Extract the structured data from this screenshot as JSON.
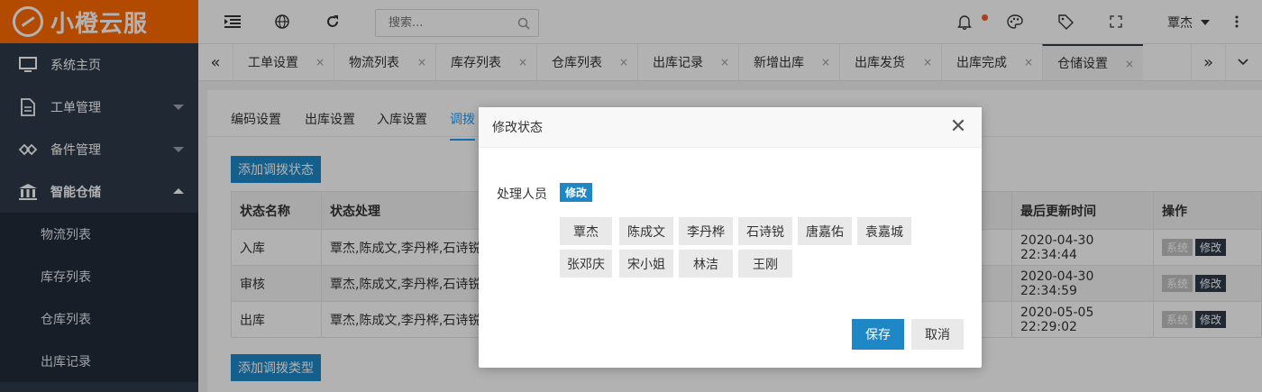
{
  "app": {
    "logo_text": "小橙云服",
    "brand_color": "#ff6a00"
  },
  "sidebar": {
    "items": [
      {
        "label": "系统主页",
        "icon": "monitor-icon"
      },
      {
        "label": "工单管理",
        "icon": "document-icon"
      },
      {
        "label": "备件管理",
        "icon": "diamond-link-icon"
      },
      {
        "label": "智能仓储",
        "icon": "bank-icon",
        "open": true
      }
    ],
    "subitems": [
      {
        "label": "物流列表"
      },
      {
        "label": "库存列表"
      },
      {
        "label": "仓库列表"
      },
      {
        "label": "出库记录"
      }
    ]
  },
  "header": {
    "search_placeholder": "搜索...",
    "user_name": "覃杰",
    "icons": [
      "menu-indent-icon",
      "globe-icon",
      "refresh-icon",
      "search-icon",
      "bell-icon",
      "palette-icon",
      "tag-icon",
      "fullscreen-icon",
      "more-vertical-icon"
    ]
  },
  "tabs": [
    {
      "label": "工单设置"
    },
    {
      "label": "物流列表"
    },
    {
      "label": "库存列表"
    },
    {
      "label": "仓库列表"
    },
    {
      "label": "出库记录"
    },
    {
      "label": "新增出库"
    },
    {
      "label": "出库发货"
    },
    {
      "label": "出库完成"
    },
    {
      "label": "仓储设置",
      "active": true
    }
  ],
  "tab_close": "×",
  "content": {
    "subtabs": [
      "编码设置",
      "出库设置",
      "入库设置",
      "调拨"
    ],
    "add_status_button": "添加调拨状态",
    "add_type_button": "添加调拨类型",
    "table": {
      "headers": [
        "状态名称",
        "状态处理",
        "最后更新时间",
        "操作"
      ],
      "rows": [
        {
          "name": "入库",
          "handlers": "覃杰,陈成文,李丹桦,石诗锐",
          "updated": "2020-04-30 22:34:44"
        },
        {
          "name": "审核",
          "handlers": "覃杰,陈成文,李丹桦,石诗锐",
          "updated": "2020-04-30 22:34:59"
        },
        {
          "name": "出库",
          "handlers": "覃杰,陈成文,李丹桦,石诗锐",
          "updated": "2020-05-05 22:29:02"
        }
      ],
      "op_system": "系统",
      "op_edit": "修改"
    }
  },
  "modal": {
    "title": "修改状态",
    "field_label": "处理人员",
    "field_edit": "修改",
    "people": [
      "覃杰",
      "陈成文",
      "李丹桦",
      "石诗锐",
      "唐嘉佑",
      "袁嘉城",
      "张邓庆",
      "宋小姐",
      "林洁",
      "王刚"
    ],
    "save": "保存",
    "cancel": "取消",
    "close_glyph": "✕"
  }
}
